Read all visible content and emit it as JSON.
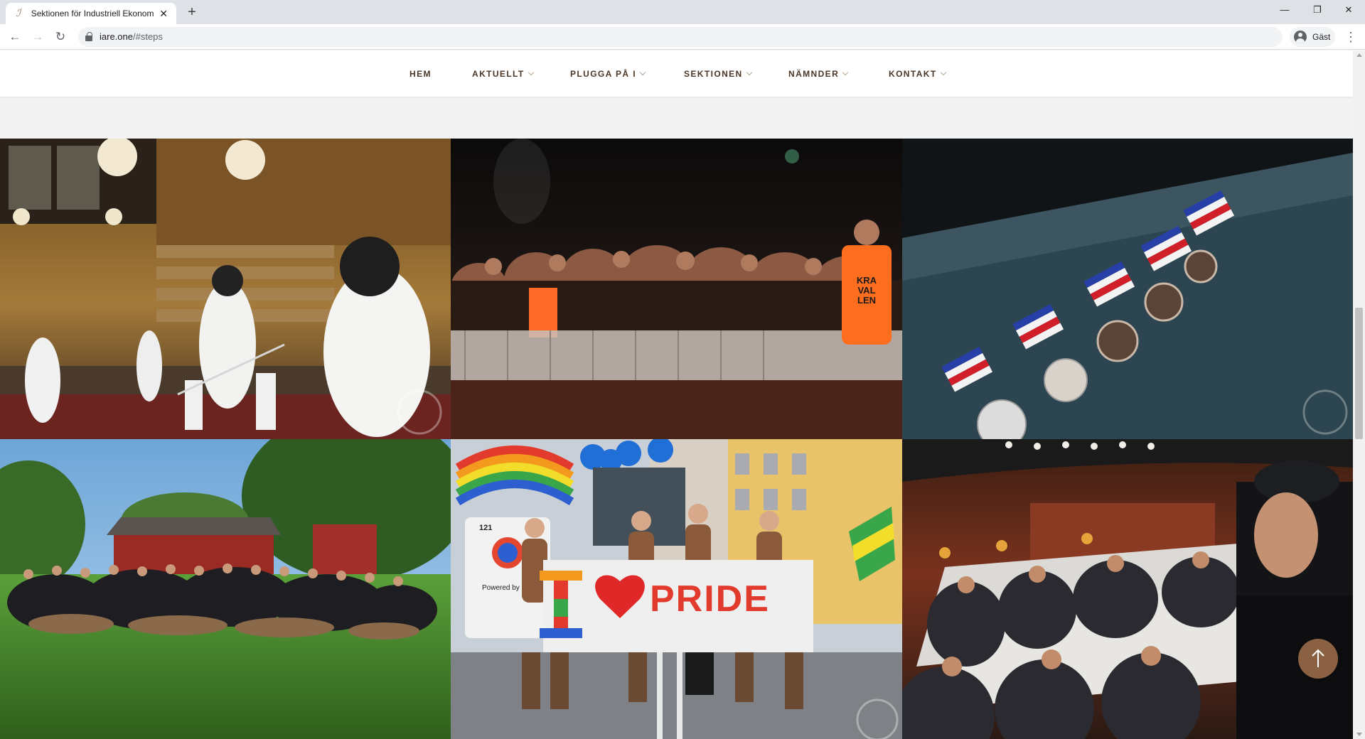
{
  "browser": {
    "tab_title": "Sektionen för Industriell Ekonomi",
    "tab_close_glyph": "✕",
    "new_tab_glyph": "+",
    "url_host": "iare.one",
    "url_path": "/#steps",
    "profile_label": "Gäst",
    "window_controls": {
      "minimize": "—",
      "maximize": "❐",
      "close": "✕"
    },
    "nav": {
      "back": "←",
      "forward": "→",
      "reload": "↻"
    },
    "menu_glyph": "⋮"
  },
  "site_nav": {
    "items": [
      {
        "label": "HEM",
        "has_dropdown": false
      },
      {
        "label": "AKTUELLT",
        "has_dropdown": true
      },
      {
        "label": "PLUGGA PÅ I",
        "has_dropdown": true
      },
      {
        "label": "SEKTIONEN",
        "has_dropdown": true
      },
      {
        "label": "NÄMNDER",
        "has_dropdown": true
      },
      {
        "label": "KONTAKT",
        "has_dropdown": true
      }
    ]
  },
  "gallery": {
    "photos": [
      {
        "name": "photo-fencing",
        "scene": "fencing"
      },
      {
        "name": "photo-concert",
        "scene": "concert"
      },
      {
        "name": "photo-medals",
        "scene": "medals"
      },
      {
        "name": "photo-group",
        "scene": "group"
      },
      {
        "name": "photo-pride",
        "scene": "pride",
        "banner_text": "PRIDE",
        "banner_letter": "I",
        "vest_text": "KRA VAL LEN"
      },
      {
        "name": "photo-dinner",
        "scene": "dinner"
      }
    ],
    "concert_vest_text": [
      "KRA",
      "VAL",
      "LEN"
    ],
    "pride_banner": {
      "letter": "I",
      "word": "PRIDE",
      "sign_text": "Powered by Diver",
      "bus_number": "121"
    }
  },
  "colors": {
    "nav_text": "#4a3627",
    "accent": "#8a6142",
    "background": "#f3f3f3"
  },
  "scroll_top": {
    "icon": "arrow-up-icon"
  },
  "scrollbar": {
    "position_fraction": 0.46
  }
}
